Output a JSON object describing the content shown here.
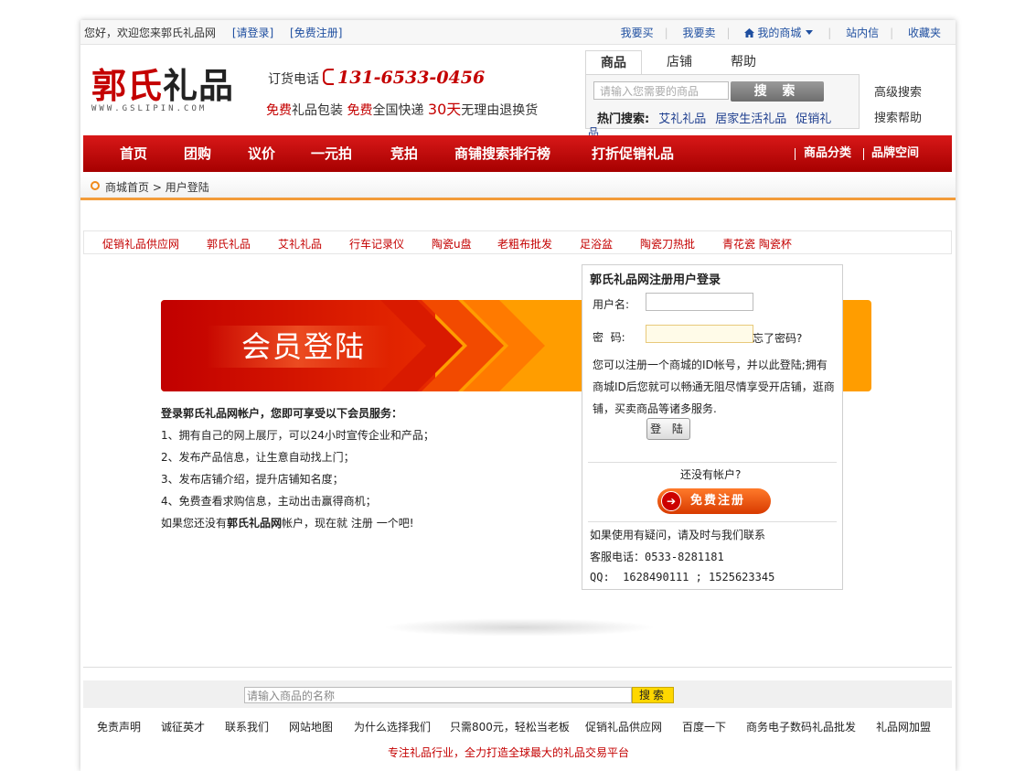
{
  "topbar": {
    "welcome": "您好，欢迎您来郭氏礼品网",
    "login": "[请登录]",
    "register": "[免费注册]",
    "links": [
      "我要买",
      "我要卖",
      "我的商城",
      "站内信",
      "收藏夹"
    ]
  },
  "logo": {
    "part1": "郭氏",
    "part2": "礼品",
    "domain": "WWW.GSLIPIN.COM"
  },
  "hotline": {
    "label": "订货电话",
    "number": "131-6533-0456"
  },
  "promo": {
    "t1": "免费",
    "t2": "礼品包装 ",
    "t3": "免费",
    "t4": "全国快递 ",
    "t5": "30天",
    "t6": "无理由退换货"
  },
  "search": {
    "tabs": [
      "商品",
      "店铺",
      "帮助"
    ],
    "placeholder": "请输入您需要的商品",
    "button": "搜 索",
    "hot_label": "热门搜索:",
    "hot_items": [
      "艾礼礼品",
      "居家生活礼品",
      "促销礼"
    ],
    "hot_wrap": "品",
    "advanced": "高级搜索",
    "help": "搜索帮助"
  },
  "nav": {
    "items": [
      "首页",
      "团购",
      "议价",
      "一元拍",
      "竞拍",
      "商铺搜索排行榜",
      "打折促销礼品"
    ],
    "right": [
      "商品分类",
      "品牌空间"
    ]
  },
  "breadcrumb": {
    "home": "商城首页",
    "current": "用户登陆"
  },
  "quick_links": [
    "促销礼品供应网",
    "郭氏礼品",
    "艾礼礼品",
    "行车记录仪",
    "陶瓷u盘",
    "老粗布批发",
    "足浴盆",
    "陶瓷刀热批",
    "青花瓷 陶瓷杯"
  ],
  "banner": {
    "title": "会员登陆"
  },
  "member": {
    "heading": "登录郭氏礼品网帐户，您即可享受以下会员服务：",
    "items": [
      "1、拥有自己的网上展厅，可以24小时宣传企业和产品；",
      "2、发布产品信息，让生意自动找上门；",
      "3、发布店铺介绍，提升店铺知名度；",
      "4、免费查看求购信息，主动出击赢得商机；"
    ],
    "footer_a": "如果您还没有",
    "footer_b": "郭氏礼品网",
    "footer_c": "帐户，现在就 ",
    "footer_link": "注册",
    "footer_d": " 一个吧!"
  },
  "login": {
    "title": "郭氏礼品网注册用户登录",
    "username_label": "用户名:",
    "password_label": "密  码:",
    "forgot": "忘了密码?",
    "note": "您可以注册一个商城的ID帐号，并以此登陆;拥有商城ID后您就可以畅通无阻尽情享受开店铺，逛商铺，买卖商品等诸多服务.",
    "button": "登 陆",
    "no_account": "还没有帐户?",
    "register_button": "免费注册",
    "contact_intro": "如果使用有疑问，请及时与我们联系",
    "service_phone": "客服电话：0533-8281181",
    "qq": "QQ:  1628490111 ; 1525623345"
  },
  "footer": {
    "search_placeholder": "请输入商品的名称",
    "search_button": "搜索",
    "links": [
      "免责声明",
      "诚征英才",
      "联系我们",
      "网站地图",
      "为什么选择我们",
      "只需800元，轻松当老板",
      "促销礼品供应网",
      "百度一下",
      "商务电子数码礼品批发",
      "礼品网加盟"
    ],
    "slogan": "专注礼品行业，全力打造全球最大的礼品交易平台"
  }
}
